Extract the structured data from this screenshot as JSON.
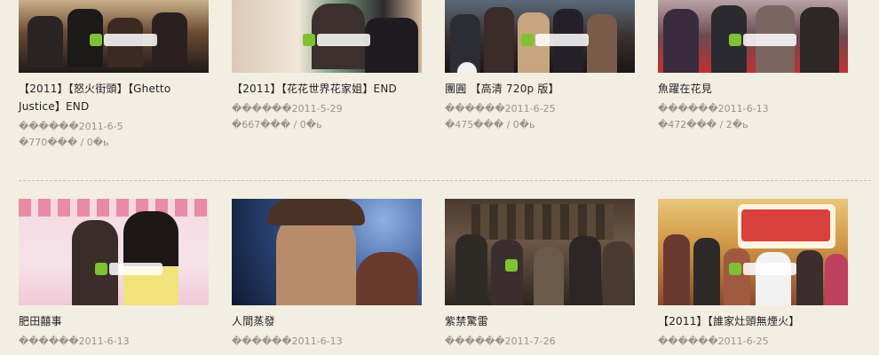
{
  "rows": [
    {
      "cards": [
        {
          "title": "【2011】【怒火街頭】【Ghetto Justice】END",
          "date": "������2011-6-5",
          "stats": "�770���  / 0�ь"
        },
        {
          "title": "【2011】【花花世界花家姐】END",
          "date": "������2011-5-29",
          "stats": "�667���  / 0�ь"
        },
        {
          "title": "團圓 【高清 720p 版】",
          "date": "������2011-6-25",
          "stats": "�475���  / 0�ь"
        },
        {
          "title": "魚躍在花見",
          "date": "������2011-6-13",
          "stats": "�472���  / 2�ь"
        }
      ]
    },
    {
      "cards": [
        {
          "title": "肥田囍事",
          "date": "������2011-6-13",
          "stats": ""
        },
        {
          "title": "人間蒸發",
          "date": "������2011-6-13",
          "stats": ""
        },
        {
          "title": "紫禁驚雷",
          "date": "������2011-7-26",
          "stats": ""
        },
        {
          "title": "【2011】【誰家灶頭無煙火】",
          "date": "������2011-6-25",
          "stats": ""
        }
      ]
    }
  ],
  "colors": {
    "background": "#f3eee2",
    "title_text": "#222222",
    "meta_text": "#9a9388",
    "android_green": "#7ec132"
  },
  "icons": [
    "android-icon"
  ]
}
